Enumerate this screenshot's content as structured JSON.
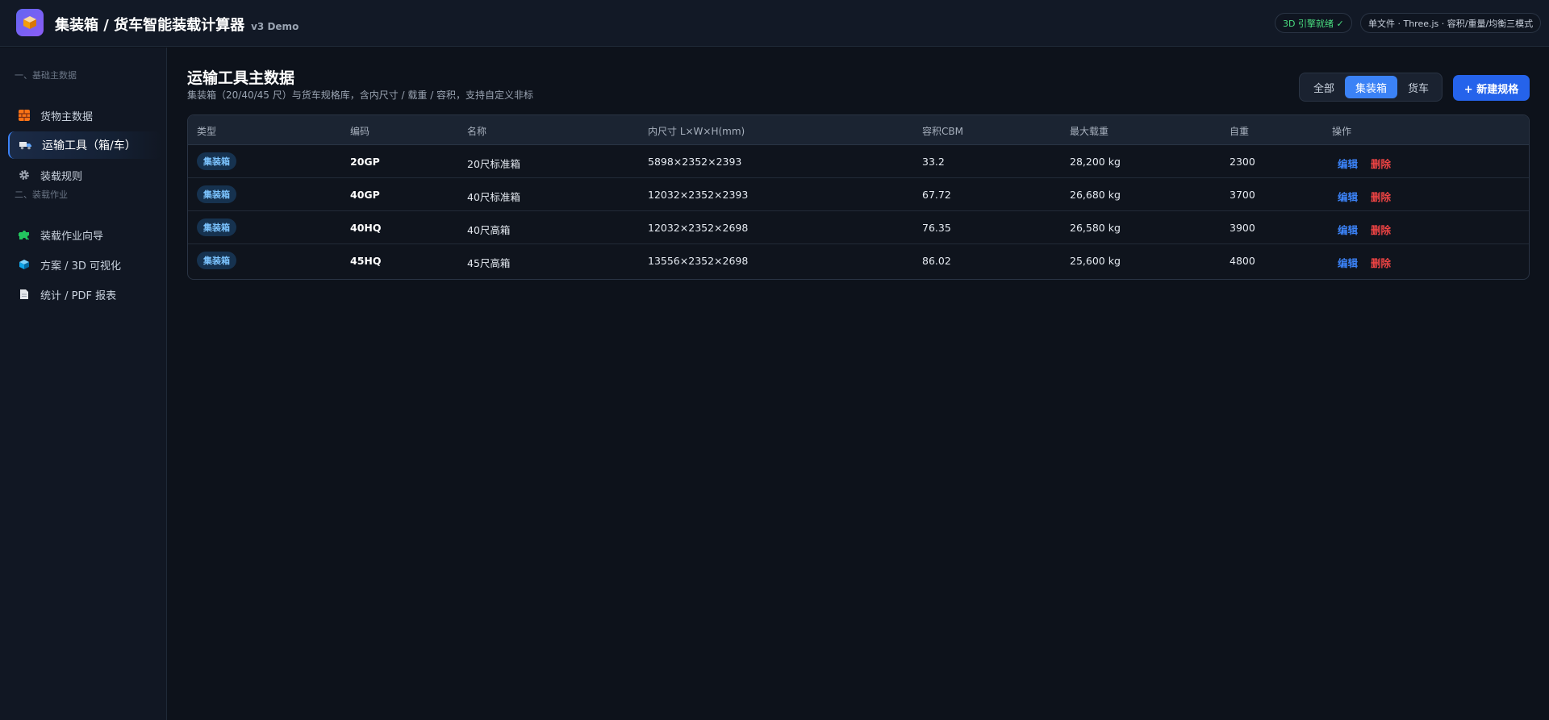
{
  "header": {
    "app_title": "集装箱 / 货车智能装载计算器",
    "version": "v3 Demo",
    "engine_status": "3D 引擎就绪 ✓",
    "mode_info": "单文件 · Three.js · 容积/重量/均衡三模式"
  },
  "sidebar": {
    "section1": "一、基础主数据",
    "section2": "二、装载作业",
    "items": [
      {
        "label": "货物主数据",
        "icon": "brick-box-icon"
      },
      {
        "label": "运输工具（箱/车）",
        "icon": "truck-icon"
      },
      {
        "label": "装载规则",
        "icon": "gear-icon"
      },
      {
        "label": "装载作业向导",
        "icon": "puzzle-icon"
      },
      {
        "label": "方案 / 3D 可视化",
        "icon": "cube-icon"
      },
      {
        "label": "统计 / PDF 报表",
        "icon": "document-icon"
      }
    ],
    "active_index": 1
  },
  "main": {
    "title": "运输工具主数据",
    "subtitle": "集装箱（20/40/45 尺）与货车规格库，含内尺寸 / 载重 / 容积，支持自定义非标",
    "filters": [
      "全部",
      "集装箱",
      "货车"
    ],
    "active_filter": "集装箱",
    "new_button": "+ 新建规格"
  },
  "table": {
    "columns": [
      "类型",
      "编码",
      "名称",
      "内尺寸 L×W×H(mm)",
      "容积CBM",
      "最大载重",
      "自重",
      "操作"
    ],
    "rows": [
      {
        "type": "集装箱",
        "code": "20GP",
        "name": "20尺标准箱",
        "dims": "5898×2352×2393",
        "cbm": "33.2",
        "max_load": "28,200 kg",
        "tare": "2300",
        "edit": "编辑",
        "delete": "删除"
      },
      {
        "type": "集装箱",
        "code": "40GP",
        "name": "40尺标准箱",
        "dims": "12032×2352×2393",
        "cbm": "67.72",
        "max_load": "26,680 kg",
        "tare": "3700",
        "edit": "编辑",
        "delete": "删除"
      },
      {
        "type": "集装箱",
        "code": "40HQ",
        "name": "40尺高箱",
        "dims": "12032×2352×2698",
        "cbm": "76.35",
        "max_load": "26,580 kg",
        "tare": "3900",
        "edit": "编辑",
        "delete": "删除"
      },
      {
        "type": "集装箱",
        "code": "45HQ",
        "name": "45尺高箱",
        "dims": "13556×2352×2698",
        "cbm": "86.02",
        "max_load": "25,600 kg",
        "tare": "4800",
        "edit": "编辑",
        "delete": "删除"
      }
    ]
  },
  "colors": {
    "accent": "#3b82f6",
    "danger": "#ef4444",
    "success": "#4ade80",
    "background": "#0d121b"
  }
}
